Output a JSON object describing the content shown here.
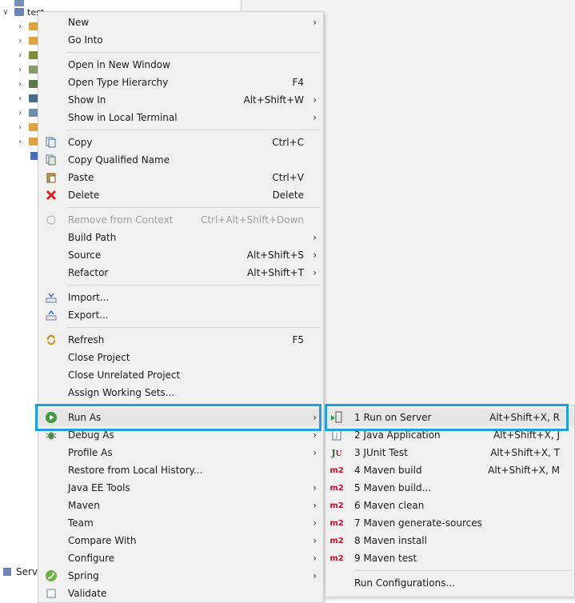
{
  "explorer": {
    "project_name": "test",
    "bottom_tab_label": "Serv"
  },
  "context_menu": {
    "items": [
      {
        "label": "New",
        "shortcut": "",
        "submenu": true
      },
      {
        "label": "Go Into",
        "shortcut": "",
        "submenu": false
      },
      {
        "label": "Open in New Window",
        "shortcut": "",
        "submenu": false
      },
      {
        "label": "Open Type Hierarchy",
        "shortcut": "F4",
        "submenu": false
      },
      {
        "label": "Show In",
        "shortcut": "Alt+Shift+W",
        "submenu": true
      },
      {
        "label": "Show in Local Terminal",
        "shortcut": "",
        "submenu": true
      },
      {
        "label": "Copy",
        "shortcut": "Ctrl+C",
        "submenu": false,
        "icon": "copy-icon"
      },
      {
        "label": "Copy Qualified Name",
        "shortcut": "",
        "submenu": false,
        "icon": "copy-qualified-icon"
      },
      {
        "label": "Paste",
        "shortcut": "Ctrl+V",
        "submenu": false,
        "icon": "paste-icon"
      },
      {
        "label": "Delete",
        "shortcut": "Delete",
        "submenu": false,
        "icon": "delete-icon"
      },
      {
        "label": "Remove from Context",
        "shortcut": "Ctrl+Alt+Shift+Down",
        "submenu": false,
        "disabled": true,
        "icon": "remove-context-icon"
      },
      {
        "label": "Build Path",
        "shortcut": "",
        "submenu": true
      },
      {
        "label": "Source",
        "shortcut": "Alt+Shift+S",
        "submenu": true
      },
      {
        "label": "Refactor",
        "shortcut": "Alt+Shift+T",
        "submenu": true
      },
      {
        "label": "Import...",
        "shortcut": "",
        "submenu": false,
        "icon": "import-icon"
      },
      {
        "label": "Export...",
        "shortcut": "",
        "submenu": false,
        "icon": "export-icon"
      },
      {
        "label": "Refresh",
        "shortcut": "F5",
        "submenu": false,
        "icon": "refresh-icon"
      },
      {
        "label": "Close Project",
        "shortcut": "",
        "submenu": false
      },
      {
        "label": "Close Unrelated Project",
        "shortcut": "",
        "submenu": false
      },
      {
        "label": "Assign Working Sets...",
        "shortcut": "",
        "submenu": false
      },
      {
        "label": "Run As",
        "shortcut": "",
        "submenu": true,
        "icon": "run-icon",
        "highlighted": true
      },
      {
        "label": "Debug As",
        "shortcut": "",
        "submenu": true,
        "icon": "debug-icon"
      },
      {
        "label": "Profile As",
        "shortcut": "",
        "submenu": true
      },
      {
        "label": "Restore from Local History...",
        "shortcut": "",
        "submenu": false
      },
      {
        "label": "Java EE Tools",
        "shortcut": "",
        "submenu": true
      },
      {
        "label": "Maven",
        "shortcut": "",
        "submenu": true
      },
      {
        "label": "Team",
        "shortcut": "",
        "submenu": true
      },
      {
        "label": "Compare With",
        "shortcut": "",
        "submenu": true
      },
      {
        "label": "Configure",
        "shortcut": "",
        "submenu": true
      },
      {
        "label": "Spring",
        "shortcut": "",
        "submenu": true,
        "icon": "spring-icon"
      },
      {
        "label": "Validate",
        "shortcut": "",
        "submenu": false,
        "icon": "validate-icon"
      }
    ]
  },
  "run_as_submenu": {
    "items": [
      {
        "label": "1 Run on Server",
        "shortcut": "Alt+Shift+X, R",
        "icon": "server-icon",
        "highlighted": true
      },
      {
        "label": "2 Java Application",
        "shortcut": "Alt+Shift+X, J",
        "icon": "java-app-icon"
      },
      {
        "label": "3 JUnit Test",
        "shortcut": "Alt+Shift+X, T",
        "icon": "junit-icon"
      },
      {
        "label": "4 Maven build",
        "shortcut": "Alt+Shift+X, M",
        "icon": "maven-icon"
      },
      {
        "label": "5 Maven build...",
        "shortcut": "",
        "icon": "maven-icon"
      },
      {
        "label": "6 Maven clean",
        "shortcut": "",
        "icon": "maven-icon"
      },
      {
        "label": "7 Maven generate-sources",
        "shortcut": "",
        "icon": "maven-icon"
      },
      {
        "label": "8 Maven install",
        "shortcut": "",
        "icon": "maven-icon"
      },
      {
        "label": "9 Maven test",
        "shortcut": "",
        "icon": "maven-icon"
      },
      {
        "label": "Run Configurations...",
        "shortcut": "",
        "icon": ""
      }
    ]
  },
  "icon_labels": {
    "maven": "m2",
    "junit_j": "J",
    "junit_u": "U"
  },
  "colors": {
    "highlight_border": "#1fa0dc",
    "menu_bg": "#f0f0f0",
    "maven_red": "#c8102e"
  }
}
